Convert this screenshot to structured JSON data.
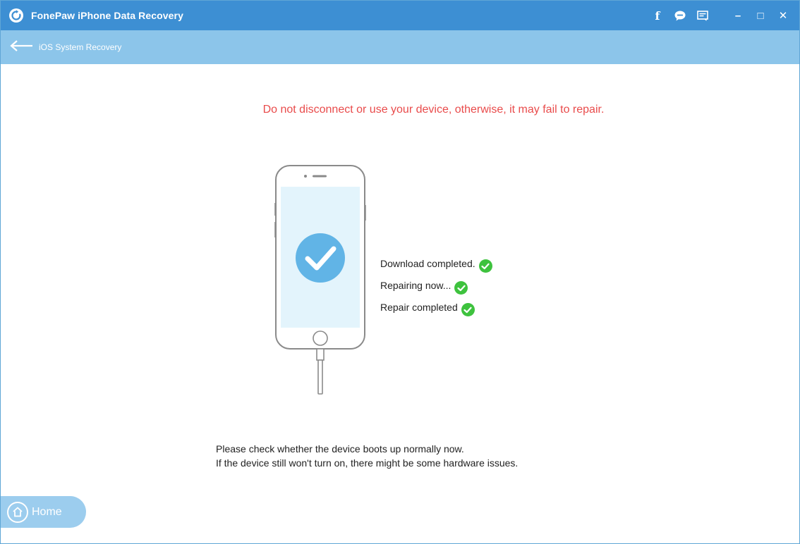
{
  "window": {
    "title": "FonePaw iPhone Data Recovery",
    "icons": {
      "logo": "refresh-icon",
      "facebook": "facebook-icon",
      "chat": "chat-bubble-icon",
      "feedback": "feedback-icon",
      "minimize": "minimize-icon",
      "maximize": "maximize-icon",
      "close": "close-icon"
    },
    "facebook_glyph": "f",
    "minimize_glyph": "–",
    "maximize_glyph": "□",
    "close_glyph": "✕"
  },
  "subbar": {
    "back_label": "iOS System Recovery",
    "back_icon": "arrow-left-icon"
  },
  "main": {
    "warning": "Do not disconnect or use your device, otherwise, it may fail to repair.",
    "phone_icon": "phone-check-icon",
    "status": [
      {
        "label": "Download completed.",
        "icon": "check-circle-icon"
      },
      {
        "label": "Repairing now...",
        "icon": "check-circle-icon"
      },
      {
        "label": "Repair completed",
        "icon": "check-circle-icon"
      }
    ],
    "info_line1": "Please check whether the device boots up normally now.",
    "info_line2": "If the device still won't turn on, there might be some hardware issues."
  },
  "footer": {
    "home_label": "Home",
    "home_icon": "home-icon"
  },
  "colors": {
    "titlebar": "#3d8fd3",
    "subbar": "#8cc5ea",
    "warning": "#e94b4b",
    "success": "#3ec23e",
    "home_button": "#9ccdee"
  }
}
